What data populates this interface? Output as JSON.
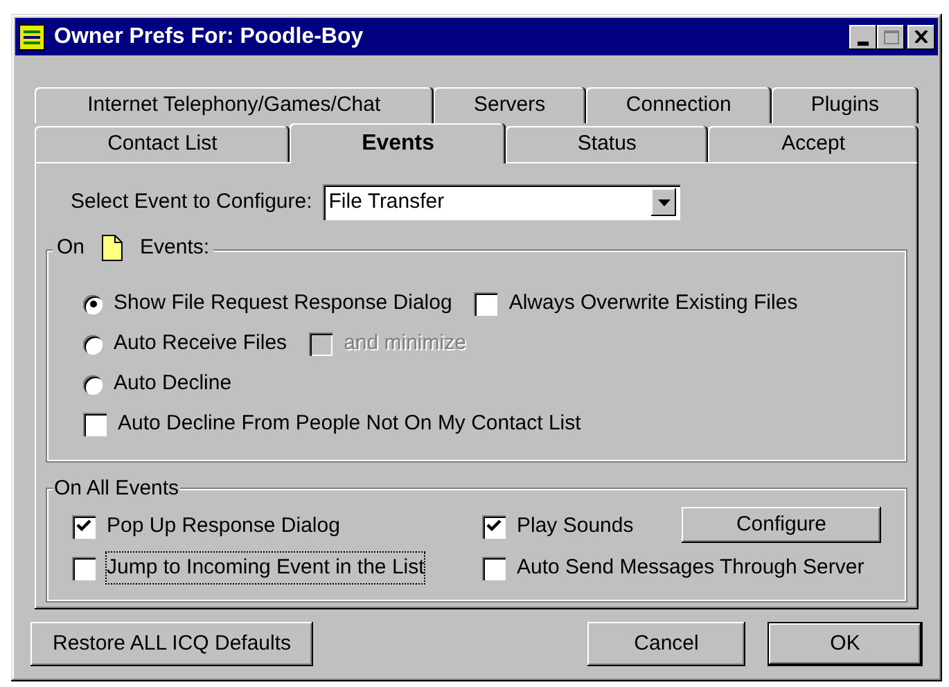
{
  "window": {
    "title": "Owner Prefs For: Poodle-Boy"
  },
  "tab_rows": [
    [
      {
        "label": "Internet Telephony/Games/Chat",
        "selected": false
      },
      {
        "label": "Servers",
        "selected": false
      },
      {
        "label": "Connection",
        "selected": false
      },
      {
        "label": "Plugins",
        "selected": false
      }
    ],
    [
      {
        "label": "Contact List",
        "selected": false
      },
      {
        "label": "Events",
        "selected": true
      },
      {
        "label": "Status",
        "selected": false
      },
      {
        "label": "Accept",
        "selected": false
      }
    ]
  ],
  "event_select": {
    "label": "Select Event to Configure:",
    "value": "File Transfer"
  },
  "event_group": {
    "label_before": "On",
    "label_after": "Events:",
    "rows": [
      {
        "kind": "radio",
        "label": "Show File Request Response Dialog",
        "selected": true,
        "extra": {
          "kind": "checkbox",
          "label": "Always Overwrite Existing Files",
          "checked": false,
          "disabled": false
        }
      },
      {
        "kind": "radio",
        "label": "Auto Receive Files",
        "selected": false,
        "extra": {
          "kind": "checkbox",
          "label": "and minimize",
          "checked": false,
          "disabled": true
        }
      },
      {
        "kind": "radio",
        "label": "Auto Decline",
        "selected": false
      },
      {
        "kind": "checkbox",
        "label": "Auto Decline From People Not On My Contact List",
        "checked": false,
        "disabled": false
      }
    ]
  },
  "all_events_group": {
    "label": "On All Events",
    "rows": [
      [
        {
          "kind": "checkbox",
          "label": "Pop Up Response Dialog",
          "checked": true,
          "focused": false
        },
        {
          "kind": "checkbox",
          "label": "Play Sounds",
          "checked": true,
          "focused": false
        },
        {
          "kind": "button",
          "label": "Configure"
        }
      ],
      [
        {
          "kind": "checkbox",
          "label": "Jump to Incoming Event in the List",
          "checked": false,
          "focused": true
        },
        {
          "kind": "checkbox",
          "label": "Auto Send Messages Through Server",
          "checked": false,
          "focused": false
        }
      ]
    ]
  },
  "buttons": [
    {
      "label": "Restore ALL ICQ Defaults",
      "default": false
    },
    {
      "label": "Cancel",
      "default": false
    },
    {
      "label": "OK",
      "default": true
    }
  ]
}
